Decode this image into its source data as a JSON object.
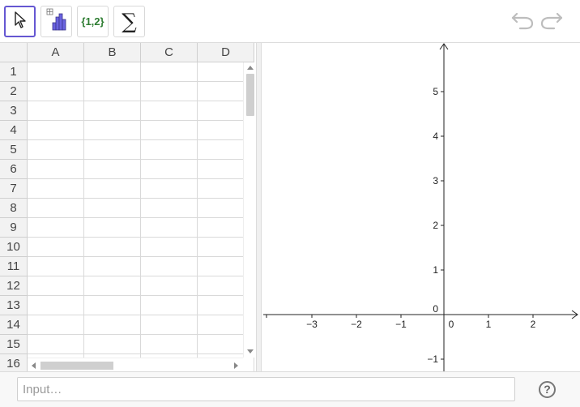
{
  "toolbar": {
    "tools": [
      {
        "id": "move",
        "icon": "cursor-arrow-icon",
        "active": true
      },
      {
        "id": "statistics",
        "icon": "bar-chart-icon",
        "active": false
      },
      {
        "id": "list",
        "label": "{1,2}",
        "active": false
      },
      {
        "id": "sum",
        "label": "∑",
        "active": false
      }
    ],
    "undo_icon": "undo-icon",
    "redo_icon": "redo-icon"
  },
  "spreadsheet": {
    "columns": [
      "A",
      "B",
      "C",
      "D"
    ],
    "rows": [
      "1",
      "2",
      "3",
      "4",
      "5",
      "6",
      "7",
      "8",
      "9",
      "10",
      "11",
      "12",
      "13",
      "14",
      "15",
      "16"
    ]
  },
  "graphics": {
    "x_ticks": [
      "−3",
      "−2",
      "−1",
      "0",
      "1",
      "2"
    ],
    "y_ticks": [
      "5",
      "4",
      "3",
      "2",
      "1",
      "−1"
    ],
    "origin_label": "0"
  },
  "input_bar": {
    "placeholder": "Input…",
    "value": "",
    "help_label": "?"
  },
  "colors": {
    "accent": "#6557d2",
    "list_tool": "#2e7d32",
    "chart_tool": "#6a63e0"
  }
}
